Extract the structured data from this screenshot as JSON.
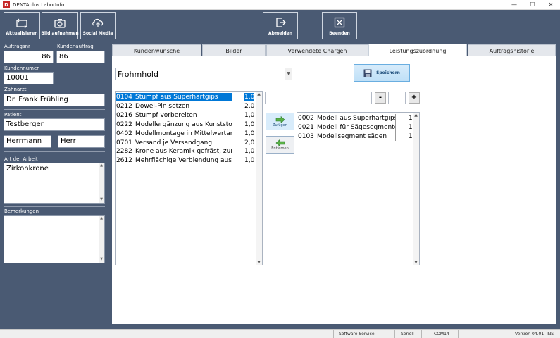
{
  "window": {
    "title": "DENTAplus LaborInfo",
    "minimize": "—",
    "maximize": "☐",
    "close": "✕"
  },
  "toolbar": {
    "refresh": "Aktualisieren",
    "photo": "Bild aufnehmen",
    "social": "Social Media",
    "logout": "Abmelden",
    "exit": "Beenden"
  },
  "left": {
    "auftragsnr_label": "Auftragsnr",
    "auftragsnr_value": "86",
    "kundenauftrag_label": "Kundenauftrag",
    "kundenauftrag_value": "86",
    "kundennummer_label": "Kundennumer",
    "kundennummer_value": "10001",
    "zahnarzt_label": "Zahnarzt",
    "zahnarzt_value": "Dr. Frank Frühling",
    "patient_label": "Patient",
    "patient_value": "Testberger",
    "patient_first": "Herrmann",
    "patient_salutation": "Herr",
    "art_label": "Art der Arbeit",
    "art_value": "Zirkonkrone",
    "bemerkungen_label": "Bemerkungen",
    "bemerkungen_value": ""
  },
  "tabs": [
    {
      "label": "Kundenwünsche"
    },
    {
      "label": "Bilder"
    },
    {
      "label": "Verwendete Chargen"
    },
    {
      "label": "Leistungszuordnung"
    },
    {
      "label": "Auftragshistorie"
    }
  ],
  "main": {
    "combo_value": "Frohmhold",
    "save_label": "Speichern",
    "minus": "-",
    "plus": "+",
    "qty_value": "",
    "add_label": "Zufügen",
    "remove_label": "Entfernen"
  },
  "available": [
    {
      "code": "0104",
      "name": "Stumpf aus Superhartgips",
      "qty": "1,0"
    },
    {
      "code": "0212",
      "name": "Dowel-Pin setzen",
      "qty": "2,0"
    },
    {
      "code": "0216",
      "name": "Stumpf vorbereiten",
      "qty": "1,0"
    },
    {
      "code": "0222",
      "name": "Modellergänzung aus Kunststoff",
      "qty": "1,0"
    },
    {
      "code": "0402",
      "name": "Modellmontage in Mittelwertartiku",
      "qty": "1,0"
    },
    {
      "code": "0701",
      "name": "Versand je Versandgang",
      "qty": "2,0"
    },
    {
      "code": "2282",
      "name": "Krone aus Keramik gefräst, zur K",
      "qty": "1,0"
    },
    {
      "code": "2612",
      "name": "Mehrflächige Verblendung aus K",
      "qty": "1,0"
    }
  ],
  "assigned": [
    {
      "code": "0002",
      "name": "Modell aus Superhartgips",
      "qty": "1,"
    },
    {
      "code": "0021",
      "name": "Modell für Sägesegmente",
      "qty": "1,"
    },
    {
      "code": "0103",
      "name": "Modellsegment sägen",
      "qty": "1,"
    }
  ],
  "status": {
    "service": "Software Service",
    "port_type": "Seriell",
    "port": "COM14",
    "version": "Version 04.01",
    "ins": "INS"
  },
  "colors": {
    "background": "#4a5a73",
    "accent": "#0078d7",
    "save_button": "#bfe0f7"
  }
}
